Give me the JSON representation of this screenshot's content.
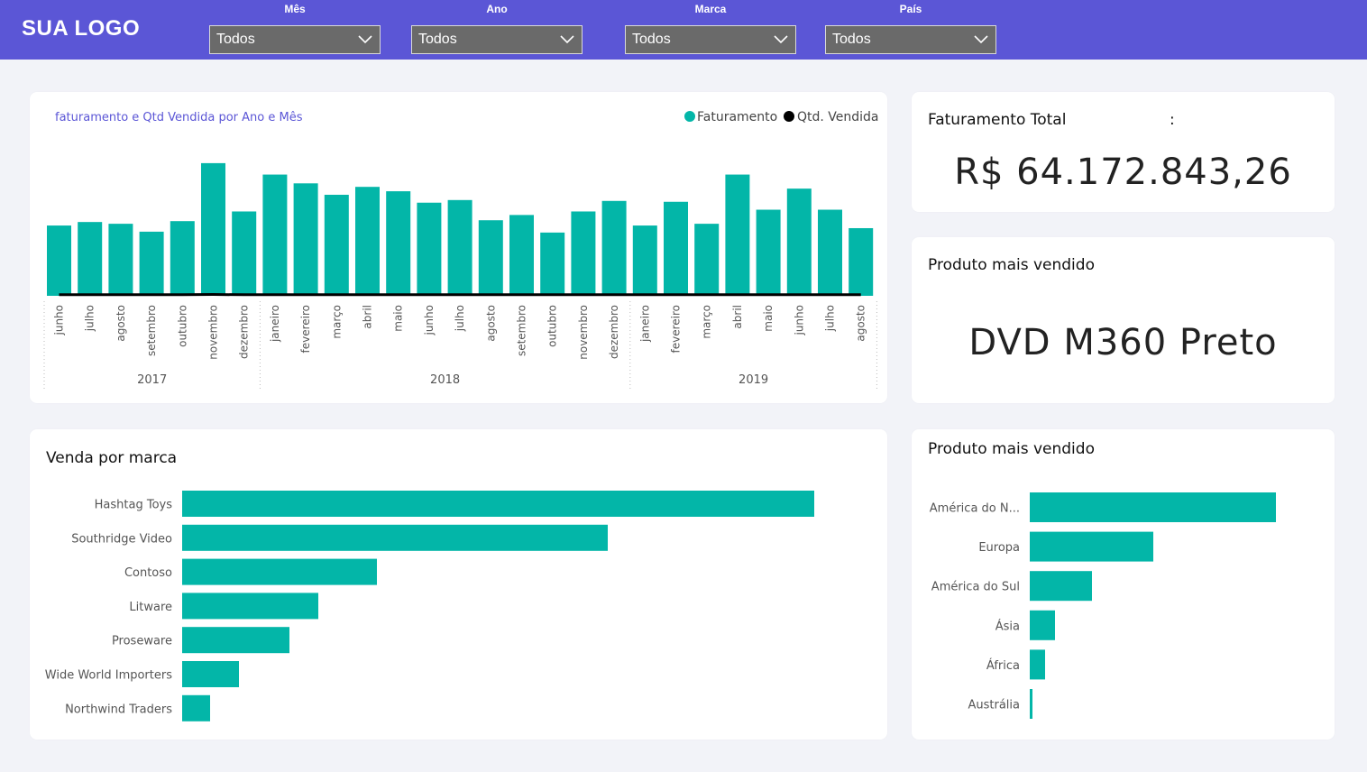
{
  "header": {
    "logo": "SUA LOGO",
    "filters": [
      {
        "label": "Mês",
        "value": "Todos"
      },
      {
        "label": "Ano",
        "value": "Todos"
      },
      {
        "label": "Marca",
        "value": "Todos"
      },
      {
        "label": "País",
        "value": "Todos"
      }
    ]
  },
  "colors": {
    "header_bg": "#5b56d6",
    "bar": "#03b6a8",
    "line": "#000000",
    "chart_title": "#5b56d6"
  },
  "kpis": {
    "faturamento_title": "Faturamento Total",
    "faturamento_colon": ":",
    "faturamento_value": "R$ 64.172.843,26",
    "produto_title": "Produto mais vendido",
    "produto_value": "DVD M360 Preto"
  },
  "chart_data": [
    {
      "type": "bar",
      "title": "faturamento e Qtd Vendida por Ano e Mês",
      "legend": [
        "Faturamento",
        "Qtd. Vendida"
      ],
      "legend_position": "top-right",
      "categories": [
        "junho",
        "julho",
        "agosto",
        "setembro",
        "outubro",
        "novembro",
        "dezembro",
        "janeiro",
        "fevereiro",
        "março",
        "abril",
        "maio",
        "junho",
        "julho",
        "agosto",
        "setembro",
        "outubro",
        "novembro",
        "dezembro",
        "janeiro",
        "fevereiro",
        "março",
        "abril",
        "maio",
        "junho",
        "julho",
        "agosto"
      ],
      "groups": [
        {
          "label": "2017",
          "count": 7
        },
        {
          "label": "2018",
          "count": 12
        },
        {
          "label": "2019",
          "count": 8
        }
      ],
      "series": [
        {
          "name": "Faturamento",
          "values": [
            80,
            84,
            82,
            73,
            85,
            151,
            96,
            138,
            128,
            115,
            124,
            119,
            106,
            109,
            86,
            92,
            72,
            96,
            108,
            80,
            107,
            82,
            138,
            98,
            122,
            98,
            77
          ]
        },
        {
          "name": "Qtd. Vendida",
          "values": [
            1,
            1,
            1,
            1,
            1,
            1.2,
            1,
            1,
            1,
            1,
            1,
            1,
            1,
            1,
            1,
            1,
            1,
            1,
            1,
            1,
            1,
            1,
            1,
            1,
            1,
            1,
            1
          ]
        }
      ],
      "ylim": [
        0,
        155
      ]
    },
    {
      "type": "bar",
      "orientation": "horizontal",
      "title": "Venda por marca",
      "categories": [
        "Hashtag Toys",
        "Southridge Video",
        "Contoso",
        "Litware",
        "Proseware",
        "Wide World Importers",
        "Northwind Traders"
      ],
      "values": [
        701,
        472,
        216,
        151,
        119,
        63,
        31
      ]
    },
    {
      "type": "bar",
      "orientation": "horizontal",
      "title": "Produto mais vendido",
      "categories": [
        "América do N...",
        "Europa",
        "América do Sul",
        "Ásia",
        "África",
        "Austrália"
      ],
      "values": [
        273,
        137,
        69,
        28,
        17,
        3
      ]
    }
  ]
}
